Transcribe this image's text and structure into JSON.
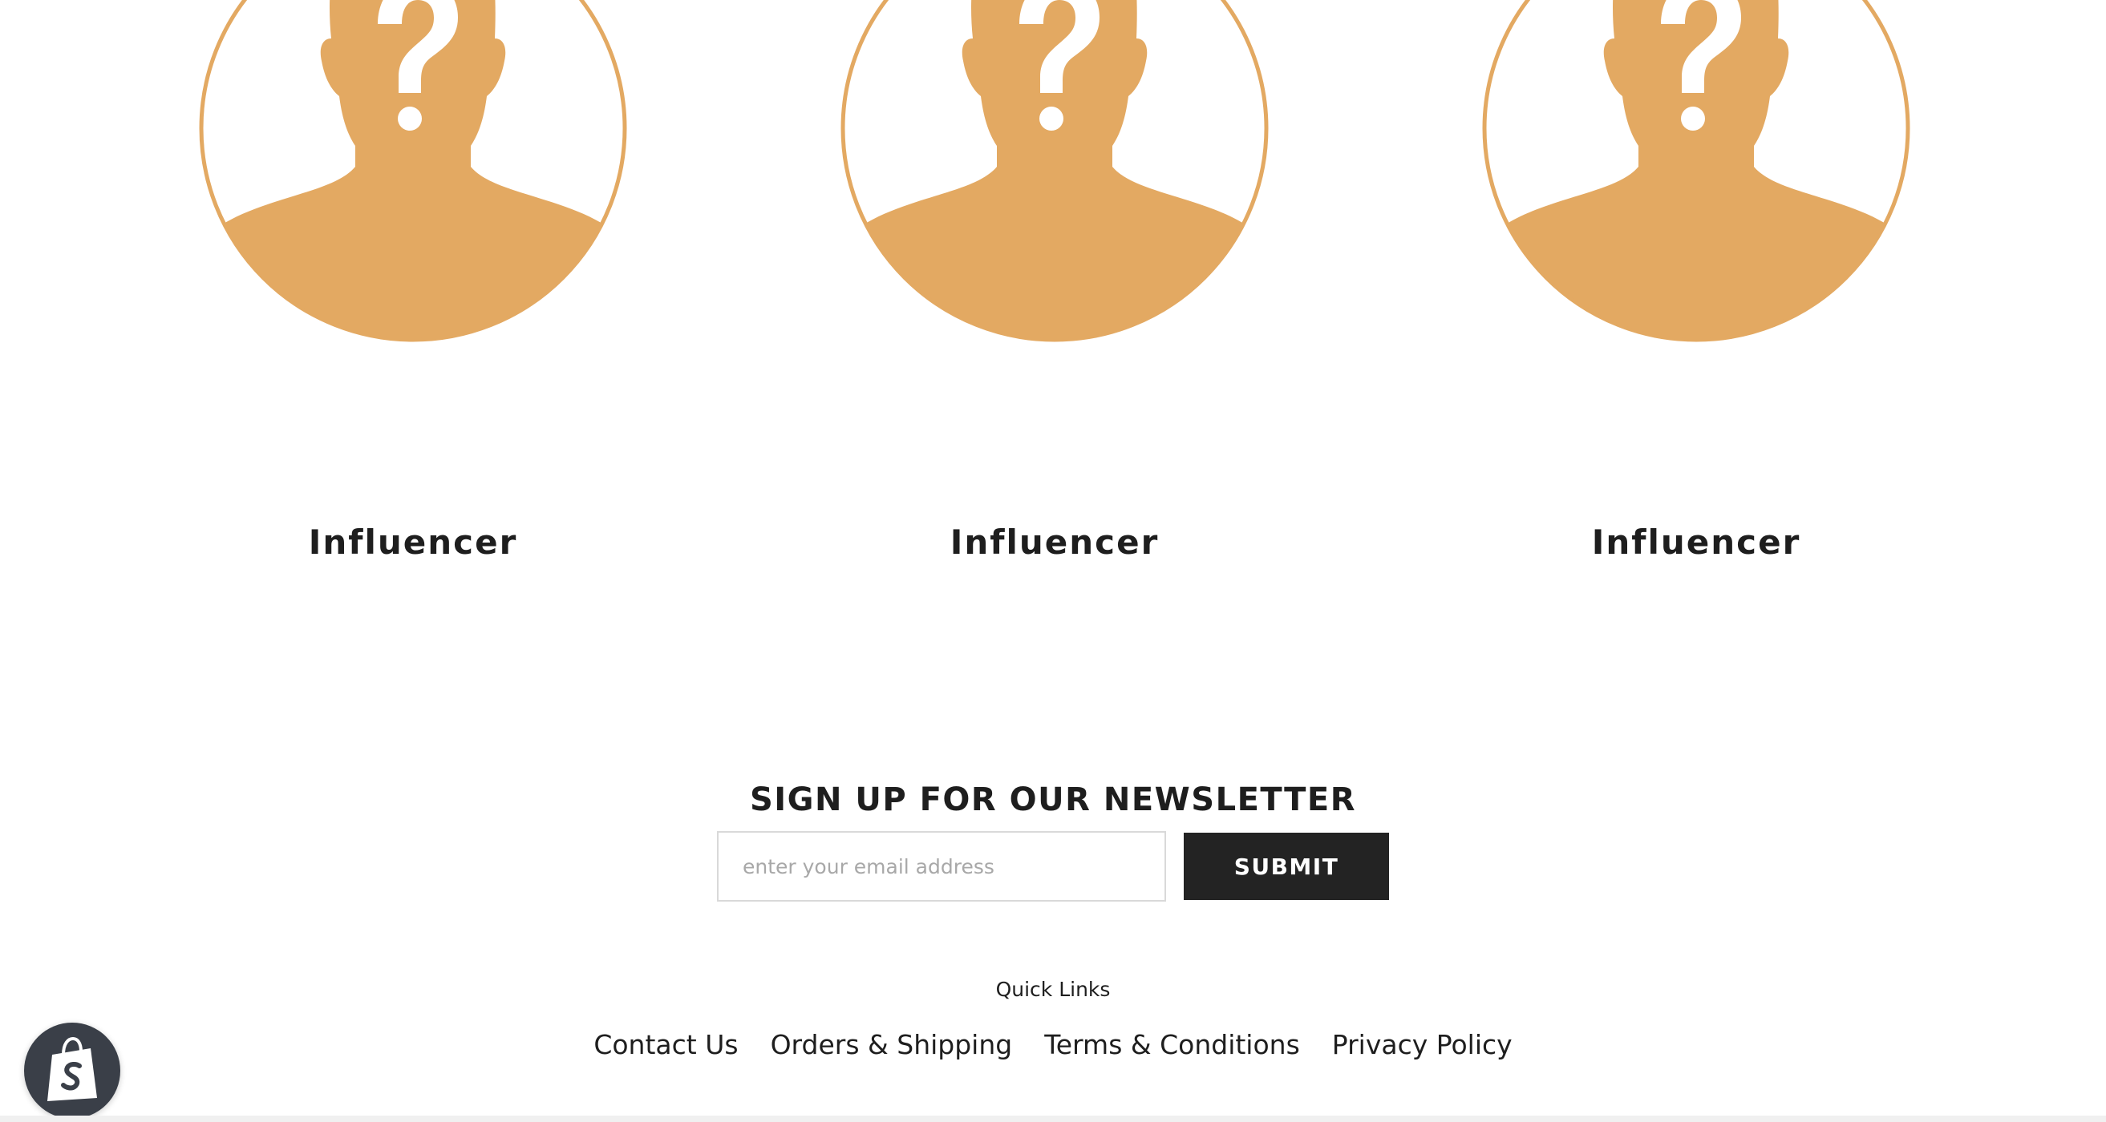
{
  "colors": {
    "avatar_accent": "#e3a962",
    "button_bg": "#232323",
    "text": "#1e1e1e",
    "badge_bg": "#3a3f48"
  },
  "influencers": [
    {
      "name": "Influencer",
      "icon": "placeholder-person-icon"
    },
    {
      "name": "Influencer",
      "icon": "placeholder-person-icon"
    },
    {
      "name": "Influencer",
      "icon": "placeholder-person-icon"
    }
  ],
  "newsletter": {
    "title": "SIGN UP FOR OUR NEWSLETTER",
    "email_placeholder": "enter your email address",
    "email_value": "",
    "submit_label": "SUBMIT"
  },
  "footer": {
    "quick_links_heading": "Quick Links",
    "links": [
      {
        "label": "Contact Us"
      },
      {
        "label": "Orders & Shipping"
      },
      {
        "label": "Terms & Conditions"
      },
      {
        "label": "Privacy Policy"
      }
    ]
  },
  "shop_badge": {
    "icon": "shopify-bag-icon"
  }
}
